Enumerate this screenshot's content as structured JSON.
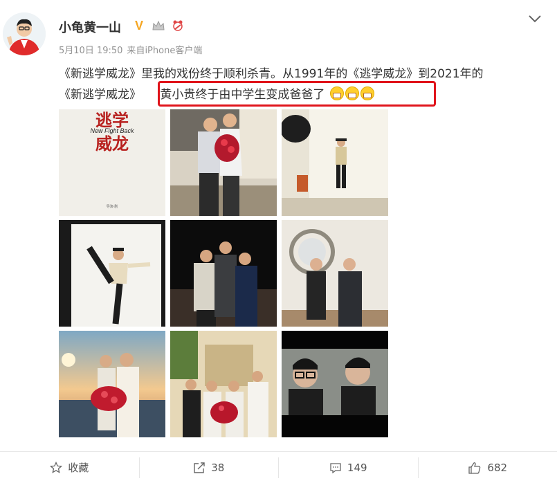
{
  "post": {
    "username": "小龟黄一山",
    "date": "5月10日 19:50",
    "source_prefix": "来自",
    "source_device": "iPhone客户端",
    "text_line1": "《新逃学威龙》里我的戏份终于顺利杀青。从1991年的《逃学威龙》到2021年的",
    "text_line2_start": "《新逃学威龙》",
    "text_line2_highlight": "黄小贵终于由中学生变成爸爸了",
    "badges": [
      "verified-v-icon",
      "crown-icon",
      "bear-icon"
    ],
    "highlight_color": "#e0141b"
  },
  "photos": {
    "poster_title": "逃学",
    "poster_title2": "威龙",
    "poster_subtitle": "New Fight Back",
    "poster_hint": "导演·剧"
  },
  "actions": {
    "favorite_label": "收藏",
    "repost_count": "38",
    "comment_count": "149",
    "like_count": "682"
  }
}
